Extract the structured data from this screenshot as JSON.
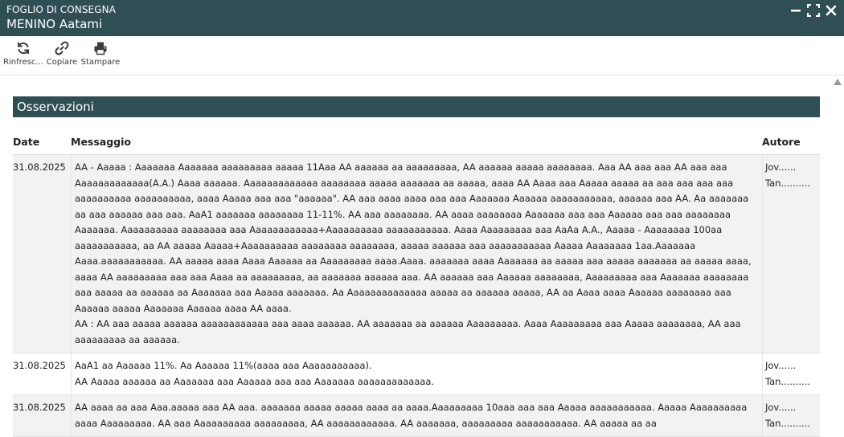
{
  "window": {
    "subtitle": "FOGLIO DI CONSEGNA",
    "title": "MENINO Aatami"
  },
  "toolbar": {
    "items": [
      {
        "label": "Rinfresc...",
        "icon": "refresh-icon"
      },
      {
        "label": "Copiare",
        "icon": "link-icon"
      },
      {
        "label": "Stampare",
        "icon": "printer-icon"
      }
    ]
  },
  "section": {
    "title": "Osservazioni"
  },
  "table": {
    "columns": [
      "Date",
      "Messaggio",
      "Autore"
    ],
    "rows": [
      {
        "date": "31.08.2025",
        "message": "AA - Aaaaa : Aaaaaaa Aaaaaaa aaaaaaaaa aaaaa 11Aaa AA aaaaaa aa aaaaaaaaa, AA aaaaaa aaaaa aaaaaaaa. Aaa AA aaa aaa AA aaa aaa Aaaaaaaaaaaaa(A.A.) Aaaa aaaaaa. Aaaaaaaaaaaaa aaaaaaaa aaaaa aaaaaaa aa aaaaa, aaaa AA Aaaa aaa Aaaaa aaaaa aa aaa aaa aaa aaa aaaaaaaaaa aaaaaaaaaa, aaaa Aaaaa aaa aaa \"aaaaaa\". AA aaa aaaa aaaa aaa aaa Aaaaaaa Aaaaaa aaaaaaaaaaa, aaaaaa aaa AA. Aa aaaaaaa aa aaa aaaaaa aaa aaa. AaA1 aaaaaaa aaaaaaaa 11-11%. AA aaa aaaaaaaa. AA aaaa aaaaaaaa Aaaaaaa aaa aaa Aaaaaa aaa aaa aaaaaaaa Aaaaaaa. Aaaaaaaaaa aaaaaaaa aaa Aaaaaaaaaaaa+Aaaaaaaaaa aaaaaaaaaaa. Aaaa Aaaaaaaaa aaa AaAa A.A., Aaaaa - Aaaaaaaa 100aa aaaaaaaaaaa, aa AA aaaaa Aaaaa+Aaaaaaaaaa aaaaaaaa aaaaaaaa, aaaaa aaaaaa aaa aaaaaaaaaaa Aaaaa Aaaaaaaa 1aa.Aaaaaaa Aaaa.aaaaaaaaaaa. AA aaaaa aaaa Aaaa Aaaaaa aa Aaaaaaaaa aaaa.Aaaa. aaaaaaa aaaa Aaaaaaa aa aaaaa aaa aaaaa aaaaaaa aa aaaaa aaaa, aaaa AA aaaaaaaaa aaa aaa Aaaa aa aaaaaaaaa, aa aaaaaaa aaaaaa aaa. AA aaaaaa aaa Aaaaaa aaaaaaaa, Aaaaaaaaa aaa Aaaaaaa aaaaaaaa aaa aaaaa aa aaaaaa aa Aaaaaaa aaa Aaaaa aaaaaaa. Aa Aaaaaaaaaaaaaa aaaaa aa aaaaaa aaaaa, AA aa Aaaa aaaa Aaaaaa aaaaaaaa aaa Aaaaaa aaaaa Aaaaaaa Aaaaaa aaaa AA aaaa.",
        "message2": "AA : AA aaa aaaaa aaaaaa aaaaaaaaaaaa aaa aaaa aaaaaa. AA aaaaaaa aa aaaaaa Aaaaaaaaa. Aaaa Aaaaaaaaa aaa Aaaaa aaaaaaaa, AA aaa aaaaaaaaa aa aaaaaa.",
        "authors": [
          "Jov......",
          "Tan.........."
        ],
        "alt": true
      },
      {
        "date": "31.08.2025",
        "message": "AaA1 aa Aaaaaa 11%. Aa Aaaaaa 11%(aaaa aaa Aaaaaaaaaaa).",
        "message2": "AA Aaaaa aaaaaa aa Aaaaaaa aaa Aaaaaa aaa aaa Aaaaaaa aaaaaaaaaaaaa.",
        "authors": [
          "Jov......",
          "Tan.........."
        ],
        "alt": false
      },
      {
        "date": "31.08.2025",
        "message": "AA aaaa aa aaa Aaa.aaaaa aaa AA aaa. aaaaaaa aaaaa aaaaa aaaa aa aaaa.Aaaaaaaaa 10aaa aaa aaa Aaaaa aaaaaaaaaaa. Aaaaa Aaaaaaaaaa aaaa Aaaaaaaaa. AA aaa Aaaaaaaaaa aaaaaaaaa, AA aaaaaaaaaaaa. AA aaaaaaa, aaaaaaaaa aaaaaaaaaaa. AA aaaaa aa aa",
        "message2": "",
        "authors": [
          "Jov......",
          "Tan.........."
        ],
        "alt": true
      }
    ]
  }
}
